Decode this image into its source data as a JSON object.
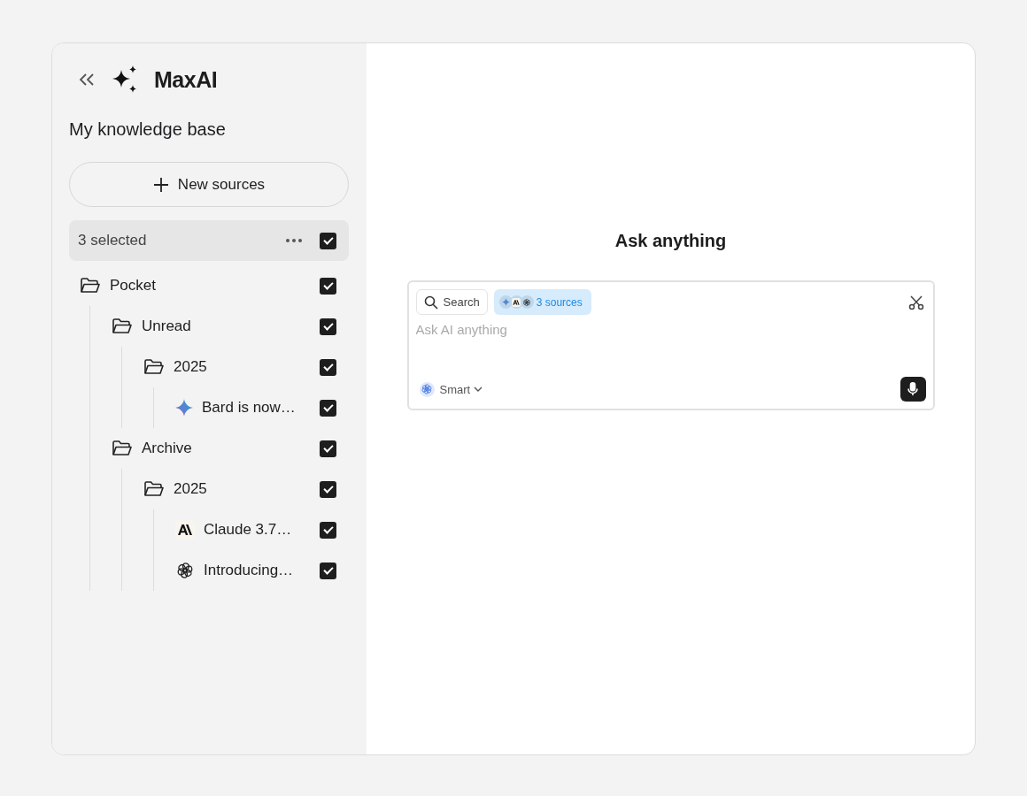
{
  "sidebar": {
    "brand": "MaxAI",
    "title": "My knowledge base",
    "new_button": "New sources",
    "selection": {
      "label": "3 selected",
      "checked": true
    },
    "tree": [
      {
        "kind": "folder",
        "label": "Pocket",
        "checked": true,
        "children": [
          {
            "kind": "folder",
            "label": "Unread",
            "checked": true,
            "children": [
              {
                "kind": "folder",
                "label": "2025",
                "checked": true,
                "children": [
                  {
                    "kind": "sparkle-doc",
                    "label": "Bard is now…",
                    "checked": true
                  }
                ]
              }
            ]
          },
          {
            "kind": "folder",
            "label": "Archive",
            "checked": true,
            "children": [
              {
                "kind": "folder",
                "label": "2025",
                "checked": true,
                "children": [
                  {
                    "kind": "letter-doc",
                    "label": "Claude 3.7…",
                    "checked": true
                  },
                  {
                    "kind": "knot-doc",
                    "label": "Introducing…",
                    "checked": true
                  }
                ]
              }
            ]
          }
        ]
      }
    ]
  },
  "main": {
    "heading": "Ask anything",
    "search_chip": "Search",
    "sources_chip": "3 sources",
    "input": {
      "placeholder": "Ask AI anything"
    },
    "model": "Smart"
  }
}
